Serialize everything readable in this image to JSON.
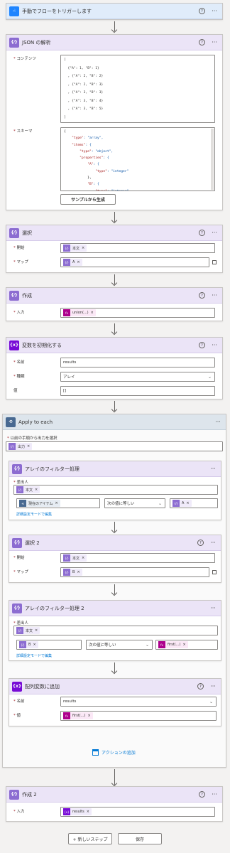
{
  "trigger": {
    "title": "手動でフローをトリガーします"
  },
  "parse_json": {
    "title": "JSON の解析",
    "content_label": "コンテンツ",
    "content_lines": [
      "[",
      "  {\"A\": 1, \"B\": 1}",
      "  , {\"A\": 2, \"B\": 2}",
      "  , {\"A\": 2, \"B\": 3}",
      "  , {\"A\": 3, \"B\": 3}",
      "  , {\"A\": 3, \"B\": 4}",
      "  , {\"A\": 3, \"B\": 5}",
      "]"
    ],
    "schema_label": "スキーマ",
    "schema_lines": [
      {
        "p": "{",
        "k": "",
        "v": ""
      },
      {
        "p": "    ",
        "k": "\"type\"",
        "v": ": \"array\","
      },
      {
        "p": "    ",
        "k": "\"items\"",
        "v": ": {"
      },
      {
        "p": "        ",
        "k": "\"type\"",
        "v": ": \"object\","
      },
      {
        "p": "        ",
        "k": "\"properties\"",
        "v": ": {"
      },
      {
        "p": "            ",
        "k": "\"A\"",
        "v": ": {"
      },
      {
        "p": "                ",
        "k": "\"type\"",
        "v": ": \"integer\""
      },
      {
        "p": "            ",
        "k": "",
        "v": "},"
      },
      {
        "p": "            ",
        "k": "\"B\"",
        "v": ": {"
      },
      {
        "p": "                ",
        "k": "\"type\"",
        "v": ": \"integer\""
      }
    ],
    "generate_button": "サンプルから生成"
  },
  "select1": {
    "title": "選択",
    "from_label": "開始",
    "from_token": "本文",
    "map_label": "マップ",
    "map_token": "A"
  },
  "compose1": {
    "title": "作成",
    "input_label": "入力",
    "input_token": "union(...)"
  },
  "init_var": {
    "title": "変数を初期化する",
    "name_label": "名前",
    "name_value": "results",
    "type_label": "種類",
    "type_value": "アレイ",
    "value_label": "値",
    "value_value": "[]"
  },
  "apply_each": {
    "title": "Apply to each",
    "select_label": "以前の手順から出力を選択",
    "output_token": "出力"
  },
  "filter1": {
    "title": "アレイのフィルター処理",
    "from_label": "差出人",
    "from_token": "本文",
    "left_token": "現在のアイテム",
    "operator": "次の値に等しい",
    "right_token": "A",
    "advanced_link": "詳細設定モードで編集"
  },
  "select2": {
    "title": "選択 2",
    "from_label": "開始",
    "from_token": "本文",
    "map_label": "マップ",
    "map_token": "B"
  },
  "filter2": {
    "title": "アレイのフィルター処理 2",
    "from_label": "差出人",
    "from_token": "本文",
    "left_token": "B",
    "operator": "次の値に等しい",
    "right_token": "first(...)",
    "advanced_link": "詳細設定モードで編集"
  },
  "append": {
    "title": "配列変数に追加",
    "name_label": "名前",
    "name_value": "results",
    "value_label": "値",
    "value_token": "first(...)"
  },
  "add_action": "アクションの追加",
  "compose2": {
    "title": "作成 2",
    "input_label": "入力",
    "input_token": "results"
  },
  "footer": {
    "new_step": "+ 新しいステップ",
    "save": "保存"
  },
  "icons": {
    "help": "?",
    "more": "···",
    "close": "×",
    "chevron": "⌄"
  },
  "colors": {
    "trigger": "#1f85ff",
    "data_operation": "#8c6cd1",
    "variable": "#770bd6",
    "expression": "#ad008c",
    "loop": "#486991",
    "link": "#0078d4"
  }
}
